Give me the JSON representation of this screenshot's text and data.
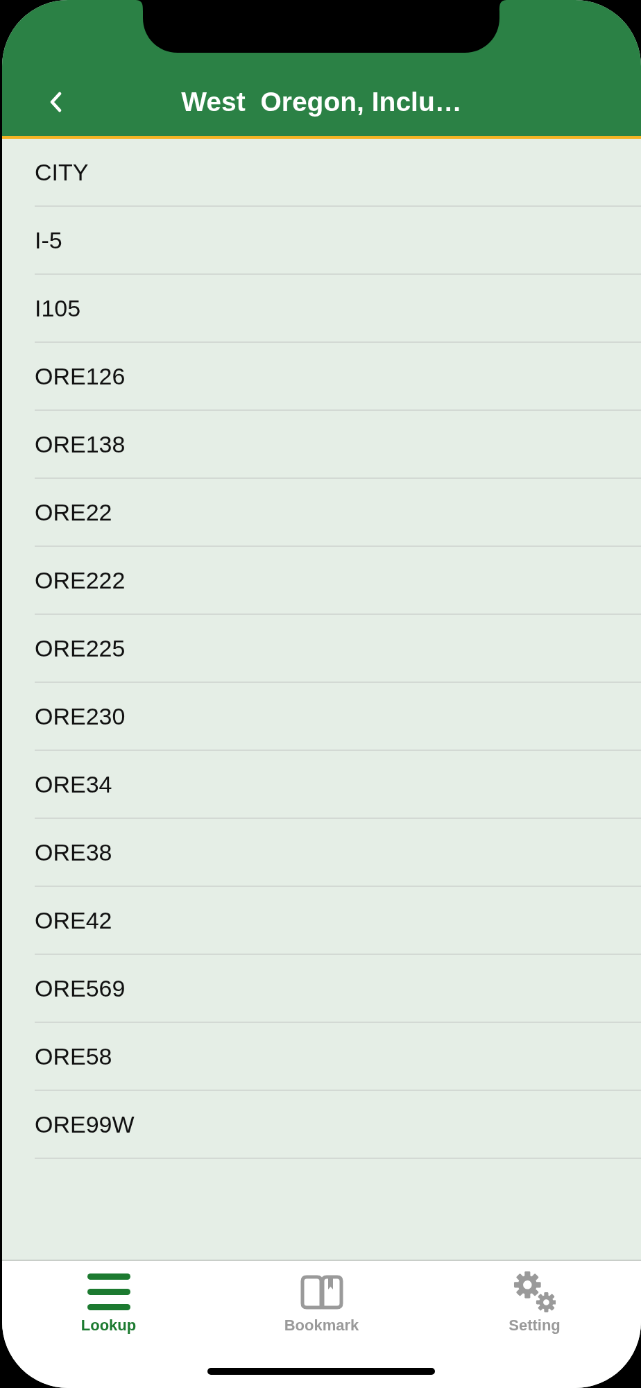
{
  "nav_bar": {
    "title": "West  Oregon, Inclu…"
  },
  "list": {
    "items": [
      "CITY",
      "I-5",
      "I105",
      "ORE126",
      "ORE138",
      "ORE22",
      "ORE222",
      "ORE225",
      "ORE230",
      "ORE34",
      "ORE38",
      "ORE42",
      "ORE569",
      "ORE58",
      "ORE99W"
    ]
  },
  "tab_bar": {
    "tabs": [
      {
        "label": "Lookup",
        "kind": "menu",
        "selected": true
      },
      {
        "label": "Bookmark",
        "kind": "book",
        "selected": false
      },
      {
        "label": "Setting",
        "kind": "gears",
        "selected": false
      }
    ]
  }
}
